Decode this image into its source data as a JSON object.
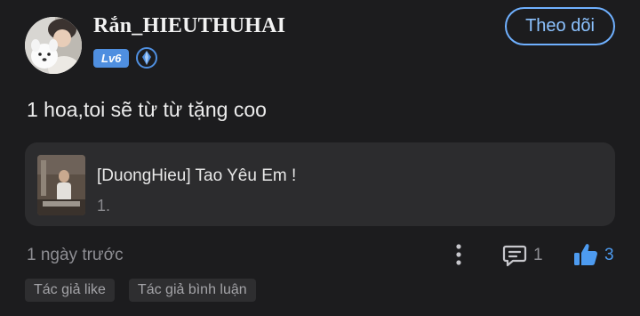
{
  "post": {
    "author": {
      "username": "Rắn_HIEUTHUHAI",
      "level": "Lv6",
      "avatar_icon": "avatar-photo",
      "badge_icon": "diamond-badge-icon"
    },
    "follow_button": "Theo dõi",
    "text": "1 hoa,toi sẽ từ từ tặng coo",
    "shared_item": {
      "title": "[DuongHieu] Tao Yêu Em !",
      "subtitle": "1.",
      "thumbnail_icon": "music-thumbnail"
    },
    "timestamp": "1 ngày trước",
    "comment_count": "1",
    "like_count": "3",
    "tags": [
      "Tác giả like",
      "Tác giả bình luận"
    ]
  },
  "colors": {
    "background": "#1c1c1e",
    "accent": "#4d9bf0",
    "follow_border": "#6fb0ff",
    "card": "#2c2c2e",
    "muted": "#8e8e93"
  }
}
